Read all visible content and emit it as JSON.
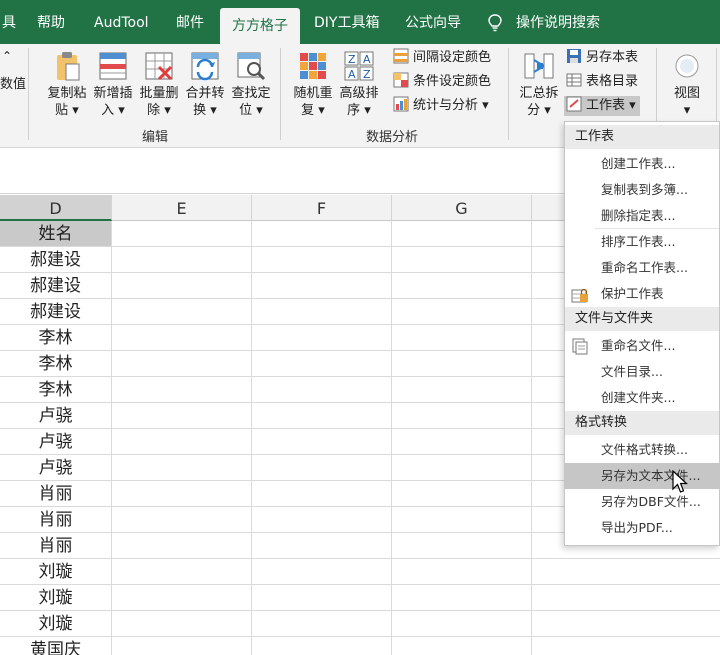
{
  "tabs": [
    {
      "label": "具",
      "active": false
    },
    {
      "label": "帮助",
      "active": false
    },
    {
      "label": "AudTool",
      "active": false
    },
    {
      "label": "邮件",
      "active": false
    },
    {
      "label": "方方格子",
      "active": true
    },
    {
      "label": "DIY工具箱",
      "active": false
    },
    {
      "label": "公式向导",
      "active": false
    },
    {
      "label": "操作说明搜索",
      "active": false
    }
  ],
  "ribbon": {
    "left_partial": {
      "label": "数值"
    },
    "buttons": [
      {
        "label": "复制粘\n贴 ▾",
        "icon": "clipboard-icon"
      },
      {
        "label": "新增插\n入 ▾",
        "icon": "insert-icon"
      },
      {
        "label": "批量删\n除 ▾",
        "icon": "delete-icon"
      },
      {
        "label": "合并转\n换 ▾",
        "icon": "merge-icon"
      },
      {
        "label": "查找定\n位 ▾",
        "icon": "find-icon"
      },
      {
        "label": "随机重\n复 ▾",
        "icon": "random-icon"
      },
      {
        "label": "高级排\n序 ▾",
        "icon": "sort-icon"
      },
      {
        "label": "汇总拆\n分 ▾",
        "icon": "summary-icon"
      },
      {
        "label": "视图\n▾",
        "icon": "view-icon"
      }
    ],
    "small_buttons": [
      {
        "label": "间隔设定颜色",
        "icon": "interval-color-icon"
      },
      {
        "label": "条件设定颜色",
        "icon": "condition-color-icon"
      },
      {
        "label": "统计与分析 ▾",
        "icon": "stats-icon"
      },
      {
        "label": "另存本表",
        "icon": "save-sheet-icon"
      },
      {
        "label": "表格目录",
        "icon": "table-dir-icon"
      },
      {
        "label": "工作表 ▾",
        "icon": "worksheet-icon"
      }
    ],
    "groups": {
      "edit": "编辑",
      "analysis": "数据分析"
    }
  },
  "columns": [
    "D",
    "E",
    "F",
    "G"
  ],
  "colors": {
    "brand": "#217346",
    "header_cell": "#c9c9c9",
    "menu_highlight": "#c6c6c6"
  },
  "rows": [
    "姓名",
    "郝建设",
    "郝建设",
    "郝建设",
    "李林",
    "李林",
    "李林",
    "卢骁",
    "卢骁",
    "卢骁",
    "肖丽",
    "肖丽",
    "肖丽",
    "刘璇",
    "刘璇",
    "刘璇",
    "黄国庆"
  ],
  "menu": {
    "sections": [
      {
        "title": "工作表",
        "items": [
          {
            "label": "创建工作表...",
            "icon": ""
          },
          {
            "label": "复制表到多簿...",
            "icon": ""
          },
          {
            "label": "删除指定表...",
            "icon": ""
          },
          {
            "label": "排序工作表...",
            "icon": ""
          },
          {
            "label": "重命名工作表...",
            "icon": ""
          },
          {
            "label": "保护工作表",
            "icon": "protect-sheet-icon"
          }
        ]
      },
      {
        "title": "文件与文件夹",
        "items": [
          {
            "label": "重命名文件...",
            "icon": "rename-file-icon"
          },
          {
            "label": "文件目录...",
            "icon": ""
          },
          {
            "label": "创建文件夹...",
            "icon": ""
          }
        ]
      },
      {
        "title": "格式转换",
        "items": [
          {
            "label": "文件格式转换...",
            "icon": ""
          },
          {
            "label": "另存为文本文件...",
            "icon": "",
            "highlighted": true
          },
          {
            "label": "另存为DBF文件...",
            "icon": ""
          },
          {
            "label": "导出为PDF...",
            "icon": ""
          }
        ]
      }
    ]
  }
}
